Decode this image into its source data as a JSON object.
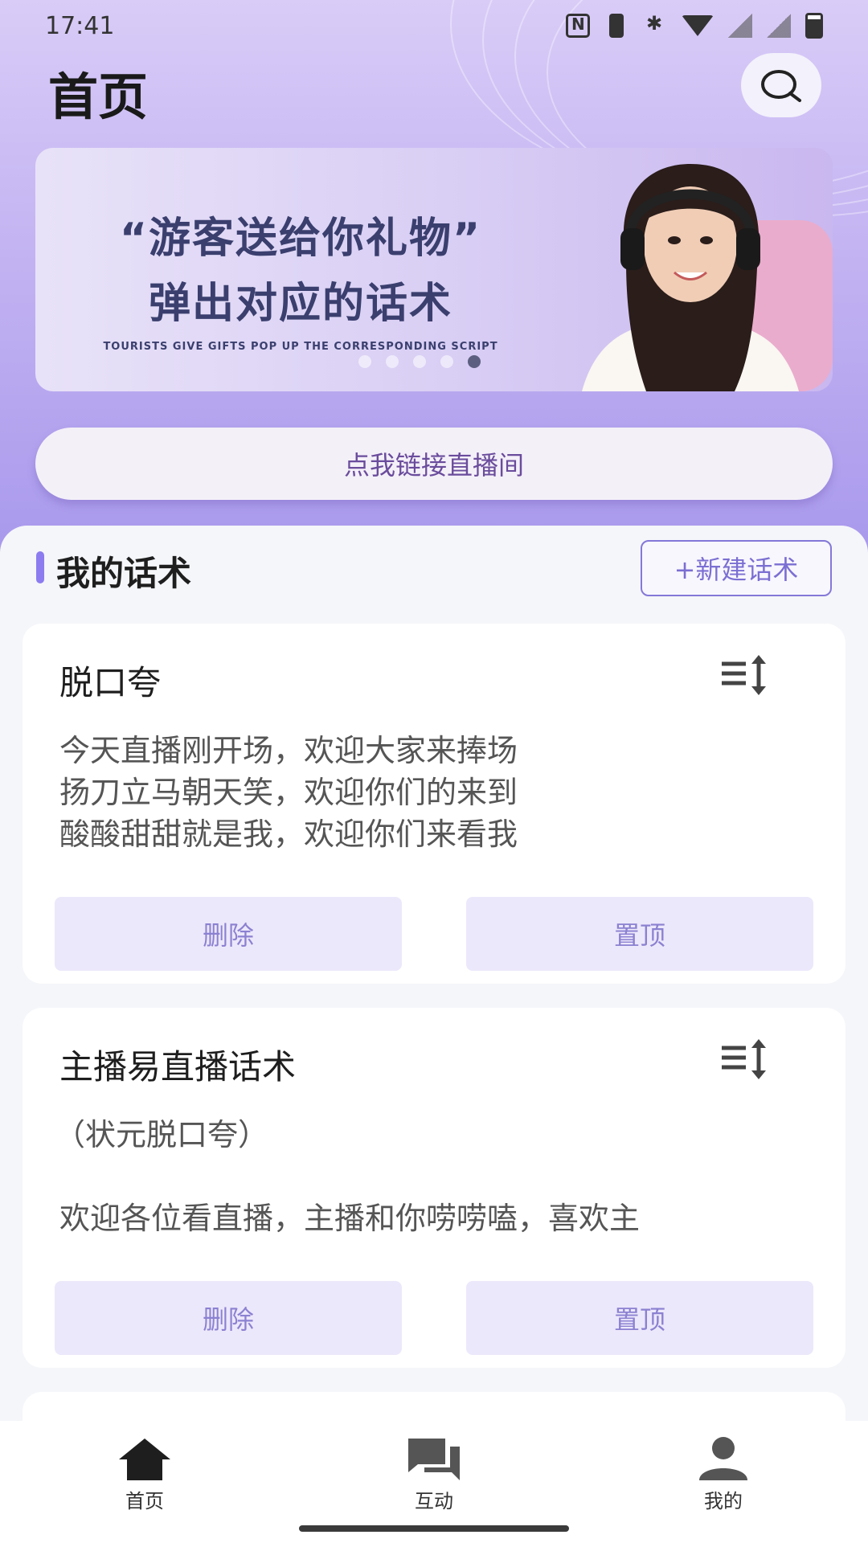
{
  "status_bar": {
    "time": "17:41",
    "icons": [
      "nfc-icon",
      "vibrate-icon",
      "bluetooth-icon",
      "wifi-icon",
      "no-signal-icon",
      "no-signal-icon",
      "battery-icon"
    ]
  },
  "header": {
    "title": "首页",
    "search_icon": "search-icon"
  },
  "banner": {
    "line1": "“游客送给你礼物”",
    "line2": "弹出对应的话术",
    "subtitle": "TOURISTS GIVE GIFTS POP UP THE CORRESPONDING SCRIPT",
    "dot_count": 5,
    "active_dot": 5
  },
  "connect_button": {
    "label": "点我链接直播间"
  },
  "section": {
    "title": "我的话术",
    "new_button": "+新建话术"
  },
  "cards": [
    {
      "title": "脱口夸",
      "subtitle": "",
      "body": "今天直播刚开场，欢迎大家来捧场\n扬刀立马朝天笑，欢迎你们的来到\n酸酸甜甜就是我，欢迎你们来看我",
      "delete_label": "删除",
      "pin_label": "置顶"
    },
    {
      "title": "主播易直播话术",
      "subtitle": "（状元脱口夸）",
      "body": "欢迎各位看直播，主播和你唠唠嗑，喜欢主",
      "delete_label": "删除",
      "pin_label": "置顶"
    }
  ],
  "bottom_nav": {
    "items": [
      {
        "label": "首页",
        "icon": "home-icon"
      },
      {
        "label": "互动",
        "icon": "chat-icon"
      },
      {
        "label": "我的",
        "icon": "profile-icon"
      }
    ]
  },
  "colors": {
    "accent": "#8c7cf0",
    "button_bg": "#ece8fb",
    "button_text": "#8b81d1"
  }
}
